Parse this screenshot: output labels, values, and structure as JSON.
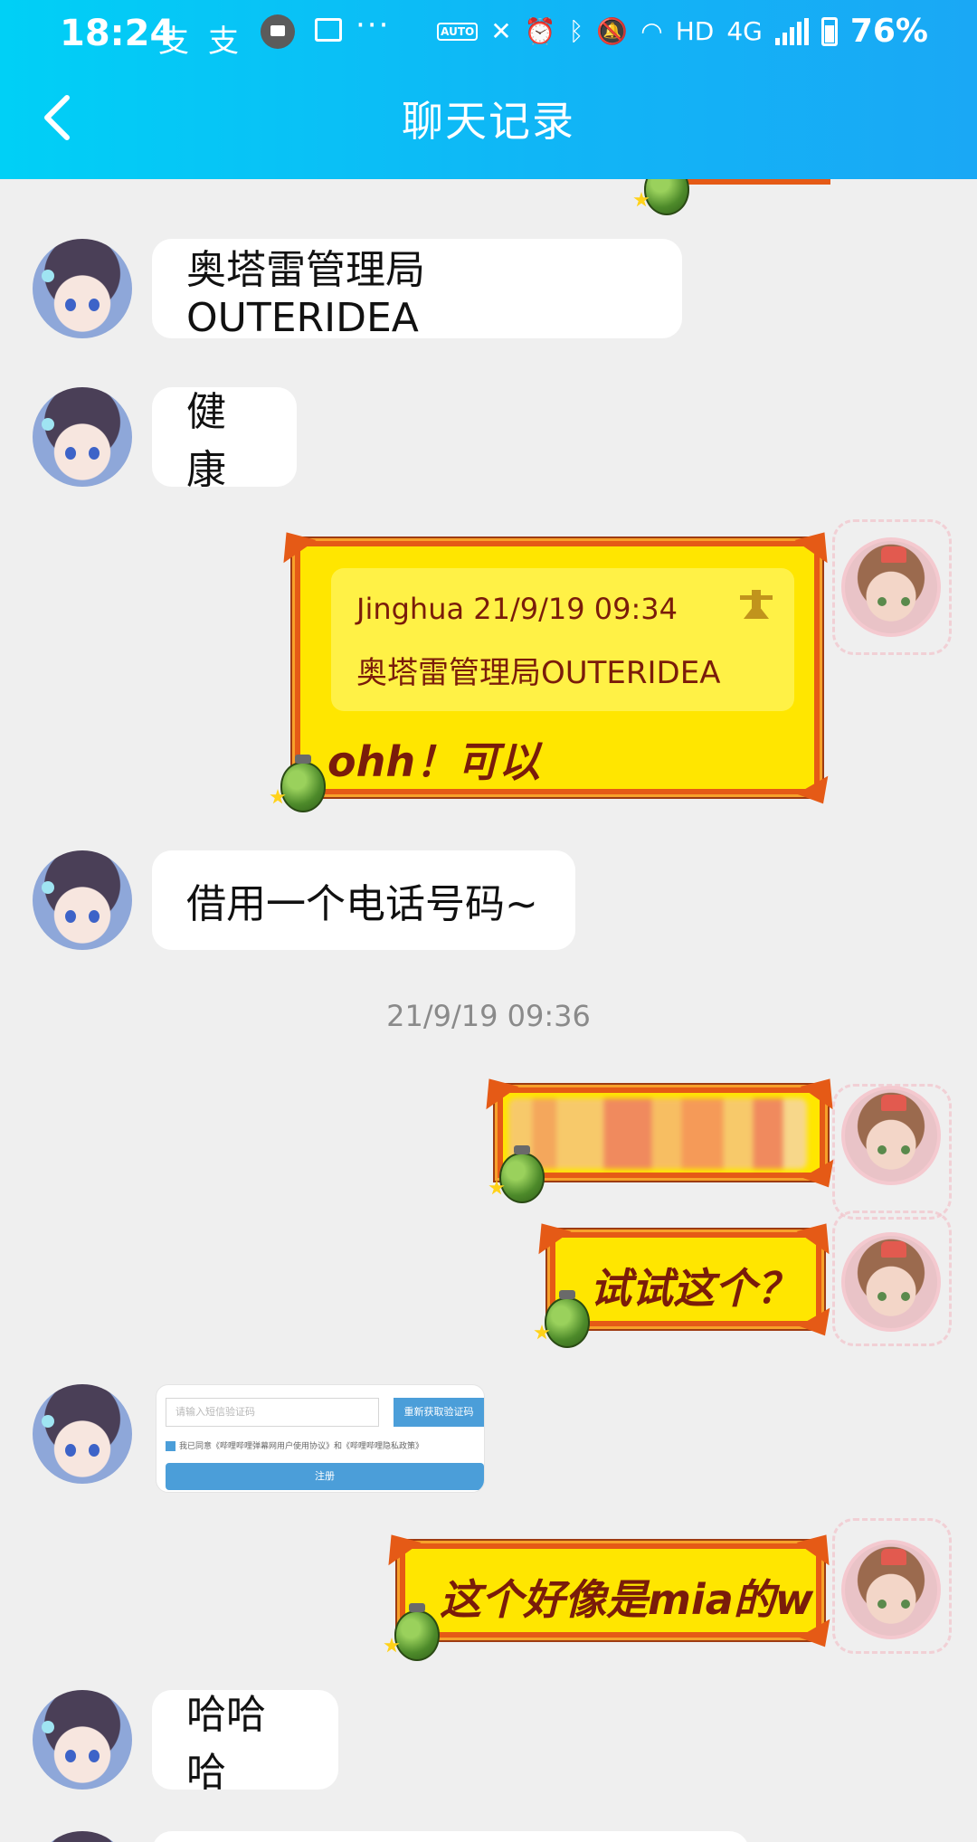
{
  "status_bar": {
    "time": "18:24",
    "notif_1": "支",
    "notif_2": "支",
    "more": "···",
    "network": "HD",
    "network_type": "4G",
    "battery_text": "76%",
    "auto_label": "AUTO"
  },
  "header": {
    "title": "聊天记录"
  },
  "messages": {
    "m1_text": "奥塔雷管理局OUTERIDEA",
    "m2_text": "健康",
    "m3_quote_author_time": "Jinghua 21/9/19 09:34",
    "m3_quote_text": "奥塔雷管理局OUTERIDEA",
    "m3_reply": "ohh！可以",
    "m4_text": "借用一个电话号码~",
    "timestamp": "21/9/19 09:36",
    "m6_text": "试试这个？",
    "m8_text": "这个好像是mia的w",
    "m9_text": "哈哈哈"
  },
  "screenshot": {
    "input_placeholder": "请输入短信验证码",
    "resend_label": "重新获取验证码",
    "agree_text": "我已同意《哔哩哔哩弹幕网用户使用协议》和《哔哩哔哩隐私政策》",
    "register_label": "注册"
  },
  "colors": {
    "header_start": "#00d0f6",
    "header_end": "#1aa8f5",
    "comic_fill": "#ffe600",
    "comic_border": "#e55a16",
    "comic_text": "#7a1c0a"
  }
}
